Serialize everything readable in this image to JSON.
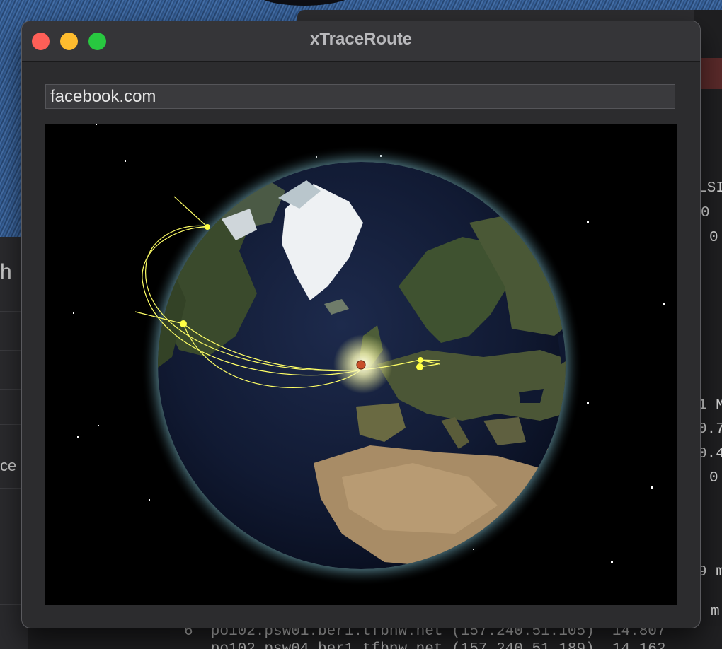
{
  "window": {
    "title": "xTraceRoute",
    "host_input_value": "facebook.com"
  },
  "background": {
    "left_window_fragments": [
      "h",
      "ce"
    ],
    "right_terminal_fragments": [
      "LSI",
      "0",
      "0",
      "1 M",
      "0.7",
      "0.4",
      "0",
      "9 m",
      "m"
    ],
    "bottom_terminal_lines": [
      "6  po102.psw01.ber1.tfbnw.net (157.240.51.105)  14.807",
      "   po102.psw04.ber1.tfbnw.net (157.240.51.189)  14.162"
    ]
  },
  "colors": {
    "route_line": "#ffff66",
    "hop_marker": "#ffff44",
    "origin_marker": "#c8502a",
    "close": "#fe5f57",
    "minimize": "#febc2e",
    "maximize": "#28c840"
  }
}
